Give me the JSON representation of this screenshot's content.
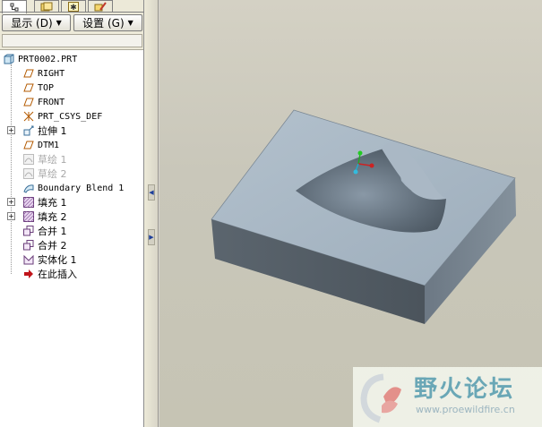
{
  "tabs": [
    {
      "name": "model-tree-tab",
      "glyph": "品"
    },
    {
      "name": "folder-tab",
      "glyph": "▭"
    },
    {
      "name": "favorites-tab",
      "glyph": "✱"
    },
    {
      "name": "tools-tab",
      "glyph": "✎"
    }
  ],
  "toolbar": {
    "show_label": "显示 (D)",
    "settings_label": "设置 (G)"
  },
  "tree": {
    "root": "PRT0002.PRT",
    "items": [
      {
        "label": "RIGHT",
        "icon": "datum-plane-icon"
      },
      {
        "label": "TOP",
        "icon": "datum-plane-icon"
      },
      {
        "label": "FRONT",
        "icon": "datum-plane-icon"
      },
      {
        "label": "PRT_CSYS_DEF",
        "icon": "csys-icon"
      },
      {
        "label": "拉伸 1",
        "icon": "extrude-icon"
      },
      {
        "label": "DTM1",
        "icon": "datum-plane-icon"
      },
      {
        "label": "草绘 1",
        "icon": "sketch-icon"
      },
      {
        "label": "草绘 2",
        "icon": "sketch-icon"
      },
      {
        "label": "Boundary Blend 1",
        "icon": "boundary-blend-icon"
      },
      {
        "label": "填充 1",
        "icon": "fill-icon"
      },
      {
        "label": "填充 2",
        "icon": "fill-icon"
      },
      {
        "label": "合并 1",
        "icon": "merge-icon"
      },
      {
        "label": "合并 2",
        "icon": "merge-icon"
      },
      {
        "label": "实体化 1",
        "icon": "solidify-icon"
      },
      {
        "label": "在此插入",
        "icon": "insert-here-arrow-icon"
      }
    ]
  },
  "watermark": {
    "title": "野火论坛",
    "url": "www.proewildfire.cn"
  },
  "colors": {
    "viewport_bg": "#c9c7ba",
    "model_top": "#a7b6c3",
    "model_front": "#56606a",
    "model_side": "#788591"
  }
}
